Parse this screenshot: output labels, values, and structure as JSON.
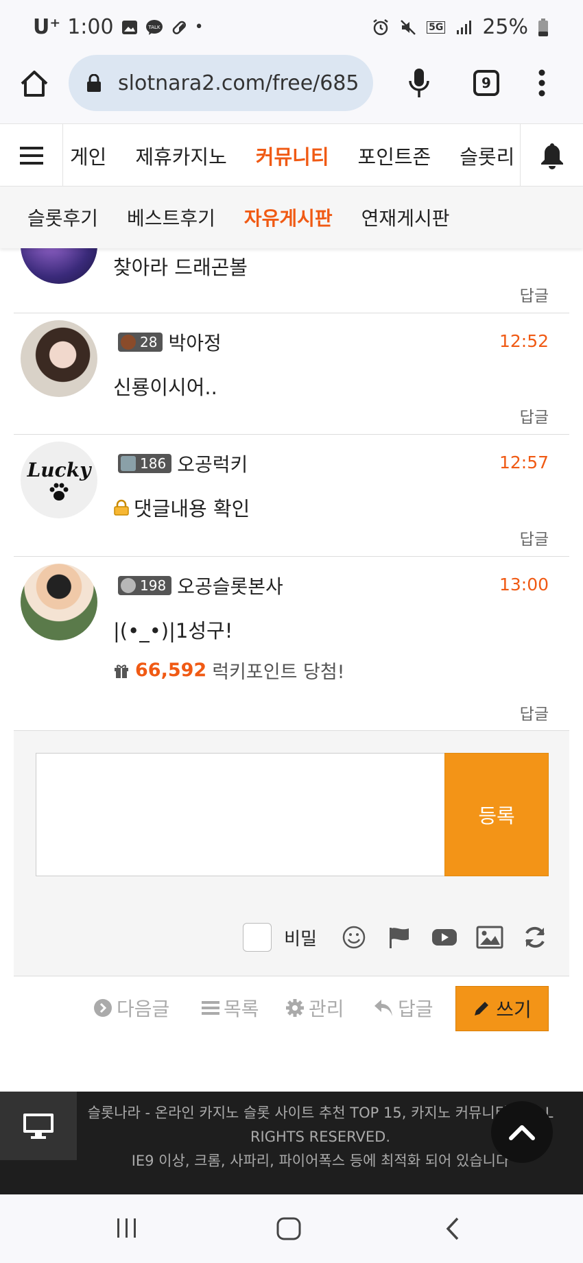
{
  "status_bar": {
    "carrier": "U⁺",
    "time": "1:00",
    "network": "5G",
    "battery": "25%",
    "icons": [
      "gallery-icon",
      "talk-icon",
      "pill-icon",
      "dot-icon",
      "alarm-icon",
      "mute-icon",
      "signal-icon",
      "battery-icon"
    ]
  },
  "browser": {
    "url": "slotnara2.com/free/685",
    "tab_count": "9"
  },
  "site_nav": {
    "items": [
      "게인",
      "제휴카지노",
      "커뮤니티",
      "포인트존",
      "슬롯리"
    ],
    "active_index": 2
  },
  "sub_nav": {
    "items": [
      "슬롯후기",
      "베스트후기",
      "자유게시판",
      "연재게시판"
    ],
    "active_index": 2
  },
  "comments": [
    {
      "text": "찾아라 드래곤볼",
      "reply": "답글"
    },
    {
      "level": "28",
      "author": "박아정",
      "time": "12:52",
      "text": "신룡이시어..",
      "reply": "답글"
    },
    {
      "level": "186",
      "author": "오공럭키",
      "time": "12:57",
      "text": "댓글내용 확인",
      "reply": "답글",
      "avatar_text": "Lucky"
    },
    {
      "level": "198",
      "author": "오공슬롯본사",
      "time": "13:00",
      "text": "|(•_•)|1성구!",
      "reply": "답글",
      "prize_amount": "66,592",
      "prize_text": "럭키포인트 당첨!"
    }
  ],
  "form": {
    "submit": "등록",
    "secret_label": "비밀",
    "tool_icons": [
      "emoji-icon",
      "flag-icon",
      "youtube-icon",
      "image-icon",
      "refresh-icon"
    ]
  },
  "bottom_buttons": {
    "next": "다음글",
    "list": "목록",
    "manage": "관리",
    "reply": "답글",
    "write": "쓰기"
  },
  "footer": {
    "line1": "슬롯나라 - 온라인 카지노 슬롯 사이트 추천 TOP 15, 카지노 커뮤니티 ©ALL RIGHTS RESERVED.",
    "line2": "IE9 이상, 크롬, 사파리, 파이어폭스 등에 최적화 되어 있습니다"
  },
  "colors": {
    "accent": "#f05a14",
    "button": "#f39417",
    "url_pill": "#dce6f2"
  }
}
